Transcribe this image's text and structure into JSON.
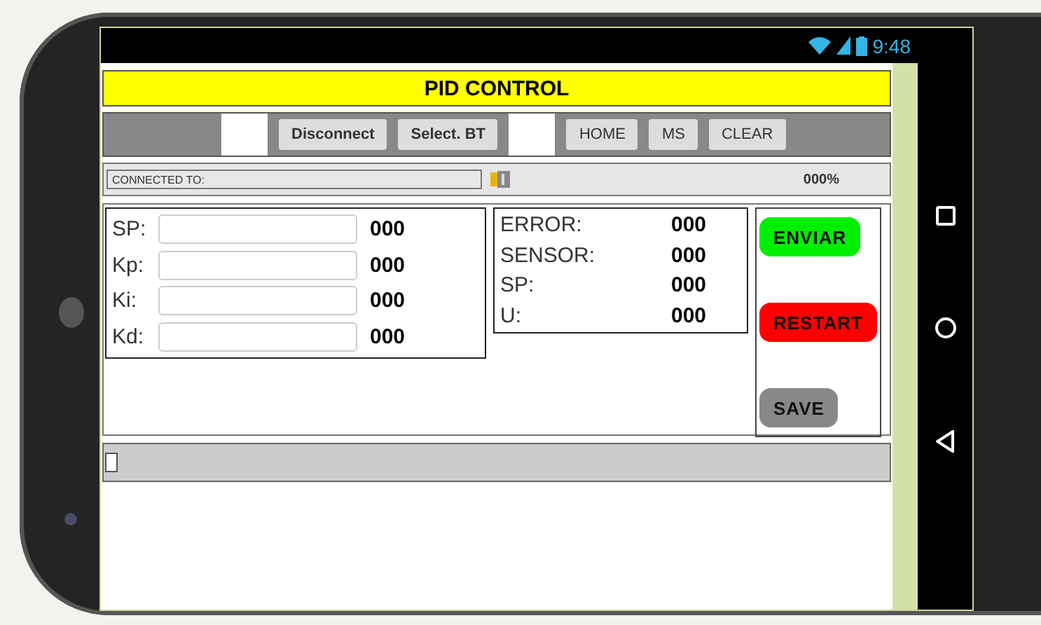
{
  "status_bar": {
    "time": "9:48"
  },
  "title": "PID CONTROL",
  "toolbar": [
    {
      "kind": "blank"
    },
    {
      "kind": "button",
      "label": "Disconnect",
      "bold": true
    },
    {
      "kind": "button",
      "label": "Select. BT",
      "bold": true
    },
    {
      "kind": "blank"
    },
    {
      "kind": "button",
      "label": "HOME",
      "bold": false
    },
    {
      "kind": "button",
      "label": "MS",
      "bold": false
    },
    {
      "kind": "button",
      "label": "CLEAR",
      "bold": false
    }
  ],
  "connection": {
    "label": "CONNECTED TO:",
    "percent": "000%"
  },
  "parameters": [
    {
      "label": "SP:",
      "value": "000"
    },
    {
      "label": "Kp:",
      "value": "000"
    },
    {
      "label": "Ki:",
      "value": "000"
    },
    {
      "label": "Kd:",
      "value": "000"
    }
  ],
  "readings": [
    {
      "label": "ERROR:",
      "value": "000"
    },
    {
      "label": "SENSOR:",
      "value": "000"
    },
    {
      "label": "SP:",
      "value": "000"
    },
    {
      "label": "U:",
      "value": "000"
    }
  ],
  "actions": [
    {
      "label": "ENVIAR",
      "color": "#00ee00"
    },
    {
      "label": "RESTART",
      "color": "#ff0000"
    },
    {
      "label": "SAVE",
      "color": "#888888"
    }
  ],
  "footer": {
    "checkbox": {
      "checked": false
    }
  }
}
